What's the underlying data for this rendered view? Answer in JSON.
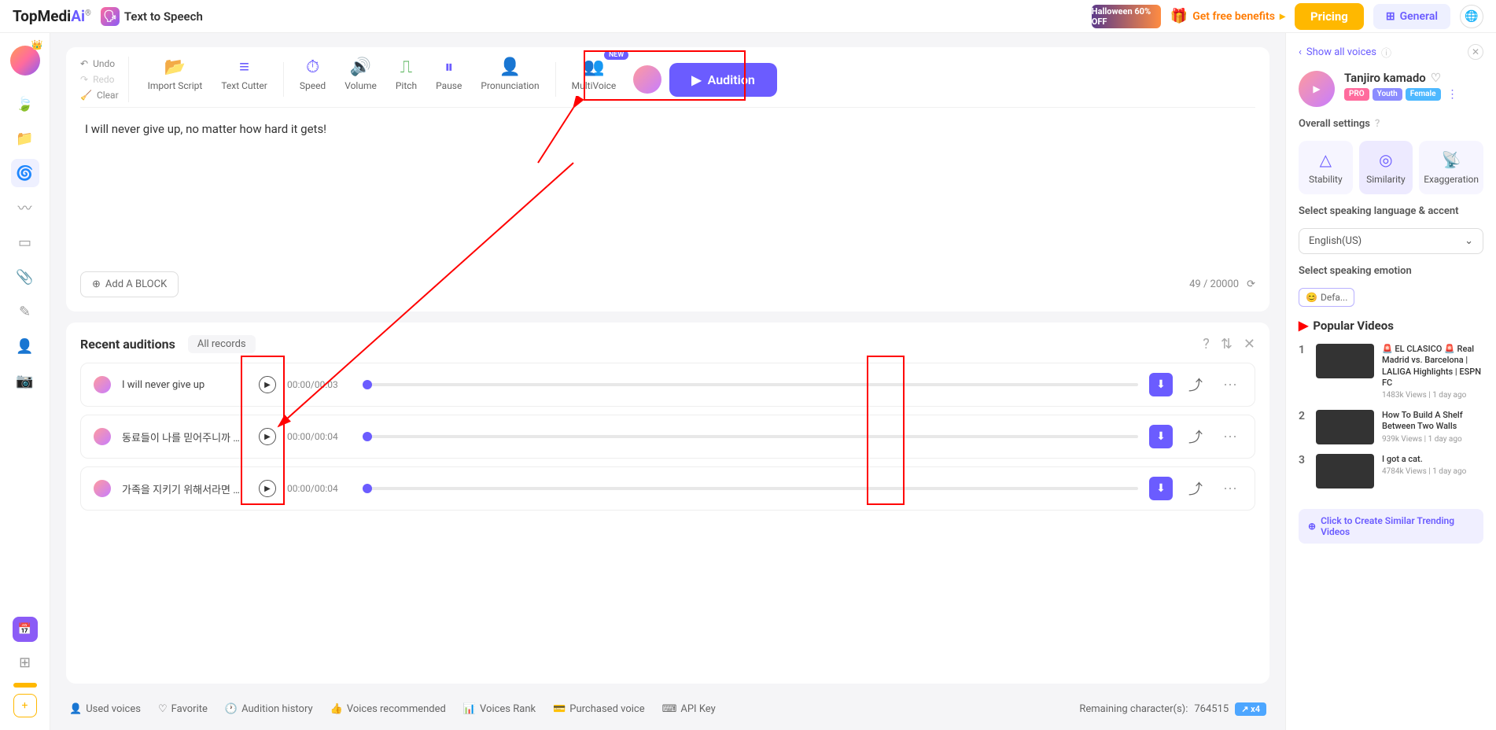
{
  "top": {
    "logo_main": "TopMedi",
    "logo_ai": "Ai",
    "tts_label": "Text to Speech",
    "halloween": "Halloween 60% OFF",
    "benefits": "Get free benefits",
    "pricing": "Pricing",
    "general": "General"
  },
  "toolbar": {
    "undo": "Undo",
    "redo": "Redo",
    "clear": "Clear",
    "import": "Import Script",
    "cutter": "Text Cutter",
    "speed": "Speed",
    "volume": "Volume",
    "pitch": "Pitch",
    "pause": "Pause",
    "pronunciation": "Pronunciation",
    "multivoice": "MultiVoice",
    "new_badge": "NEW",
    "audition": "Audition"
  },
  "editor": {
    "text": "I will never give up, no matter how hard it gets!",
    "add_block": "Add A BLOCK",
    "char_current": "49",
    "char_max": "/ 20000"
  },
  "recent": {
    "title": "Recent auditions",
    "all_records": "All records",
    "rows": [
      {
        "text": "I will never give up",
        "time": "00:00/00:03"
      },
      {
        "text": "동료들이 나를 믿어주니까 난 ...",
        "time": "00:00/00:04"
      },
      {
        "text": "가족을 지키기 위해서라면 난 ...",
        "time": "00:00/00:04"
      }
    ]
  },
  "bottom": {
    "used_voices": "Used voices",
    "favorite": "Favorite",
    "history": "Audition history",
    "recommended": "Voices recommended",
    "rank": "Voices Rank",
    "purchased": "Purchased voice",
    "api": "API Key",
    "remaining_label": "Remaining character(s):",
    "remaining_value": "764515",
    "multiplier": "x4"
  },
  "right": {
    "show_all": "Show all voices",
    "voice_name": "Tanjiro kamado",
    "tag_pro": "PRO",
    "tag_youth": "Youth",
    "tag_female": "Female",
    "overall": "Overall settings",
    "stability": "Stability",
    "similarity": "Similarity",
    "exaggeration": "Exaggeration",
    "lang_label": "Select speaking language & accent",
    "lang_value": "English(US)",
    "emotion_label": "Select speaking emotion",
    "emotion_value": "Defa...",
    "popular": "Popular Videos",
    "videos": [
      {
        "num": "1",
        "title": "🚨 EL CLASICO 🚨 Real Madrid vs. Barcelona | LALIGA Highlights | ESPN FC",
        "meta": "1483k Views | 1 day ago"
      },
      {
        "num": "2",
        "title": "How To Build A Shelf Between Two Walls",
        "meta": "939k Views | 1 day ago"
      },
      {
        "num": "3",
        "title": "I got a cat.",
        "meta": "4784k Views | 1 day ago"
      }
    ],
    "trending": "Click to Create Similar Trending Videos"
  }
}
